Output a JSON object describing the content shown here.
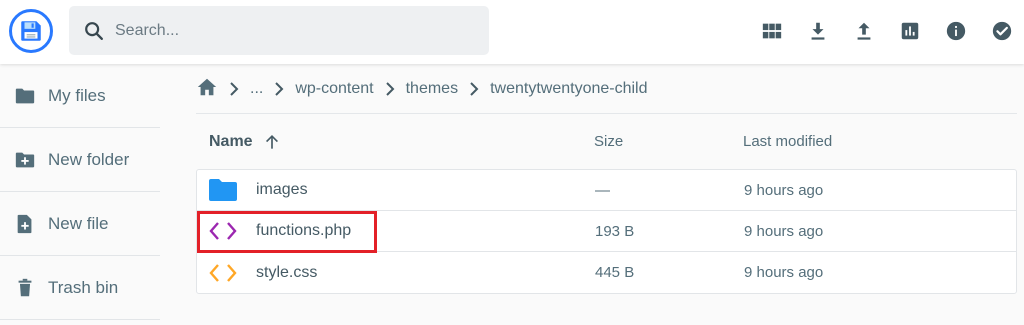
{
  "header": {
    "search_placeholder": "Search...",
    "actions": [
      "grid-view-icon",
      "download-icon",
      "upload-icon",
      "stats-icon",
      "info-icon",
      "check-circle-icon"
    ]
  },
  "sidebar": {
    "items": [
      {
        "label": "My files",
        "icon": "folder-icon"
      },
      {
        "label": "New folder",
        "icon": "new-folder-icon"
      },
      {
        "label": "New file",
        "icon": "new-file-icon"
      },
      {
        "label": "Trash bin",
        "icon": "trash-icon"
      }
    ]
  },
  "breadcrumb": {
    "items": [
      "...",
      "wp-content",
      "themes",
      "twentytwentyone-child"
    ]
  },
  "table": {
    "columns": {
      "name": "Name",
      "size": "Size",
      "modified": "Last modified"
    },
    "rows": [
      {
        "name": "images",
        "size": "—",
        "modified": "9 hours ago",
        "icon": "folder-icon"
      },
      {
        "name": "functions.php",
        "size": "193 B",
        "modified": "9 hours ago",
        "icon": "code-icon"
      },
      {
        "name": "style.css",
        "size": "445 B",
        "modified": "9 hours ago",
        "icon": "code-icon"
      }
    ]
  },
  "colors": {
    "accent": "#2979ff",
    "folder": "#2196f3",
    "php_icon": "#9c27b0",
    "css_icon": "#ffa726",
    "highlight": "#e32028"
  }
}
